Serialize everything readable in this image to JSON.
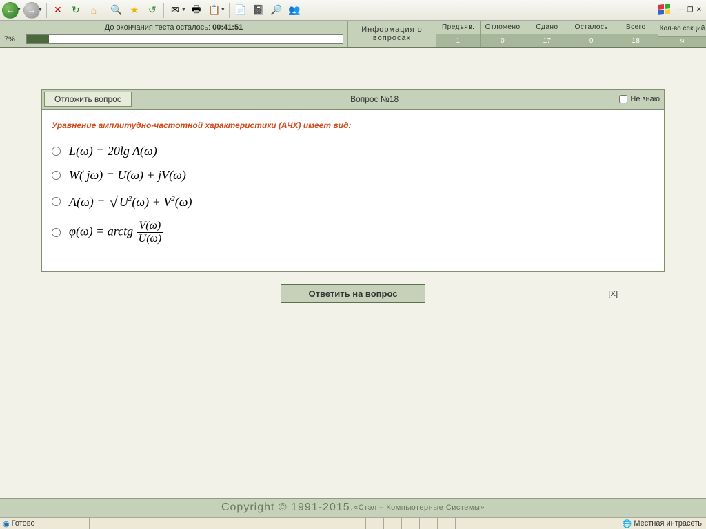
{
  "toolbar": {
    "back": "←",
    "forward": "→",
    "stop": "✕",
    "refresh": "↻",
    "home": "⌂",
    "search": "🔍",
    "favorites": "★",
    "history": "↺",
    "mail": "✉",
    "print": "🖶",
    "edit": "📋",
    "notes": "📄",
    "office": "📓",
    "research": "🔎",
    "messenger": "👥"
  },
  "wincontrols": {
    "min": "—",
    "restore": "❐",
    "close": "✕"
  },
  "timer": {
    "label_prefix": "До окончания теста осталось: ",
    "value": "00:41:51",
    "percent": "7%"
  },
  "info_label_line1": "Информация о",
  "info_label_line2": "вопросах",
  "stats": {
    "headers": [
      "Предъяв.",
      "Отложено",
      "Сдано",
      "Осталось",
      "Всего"
    ],
    "values": [
      "1",
      "0",
      "17",
      "0",
      "18"
    ]
  },
  "sections": {
    "label": "Кол-во секций",
    "value": "9"
  },
  "question": {
    "postpone": "Отложить вопрос",
    "title": "Вопрос  №18",
    "dont_know": "Не знаю",
    "prompt": "Уравнение амплитудно-частотной характеристики (АЧХ) имеет вид:",
    "answer_btn": "Ответить на вопрос",
    "close_x": "[X]"
  },
  "options": {
    "opt1": "L(ω) = 20lg A(ω)",
    "opt2": "W( jω) = U(ω) + jV(ω)",
    "opt3_inner": "U²(ω) + V²(ω)",
    "opt3_prefix": "A(ω) = ",
    "opt4_prefix": "φ(ω) = arctg ",
    "opt4_num": "V(ω)",
    "opt4_den": "U(ω)"
  },
  "copyright": {
    "main": "Copyright  © 1991-2015. ",
    "sub": "«Стэл – Компьютерные Системы»"
  },
  "status": {
    "ready": "Готово",
    "zone": "Местная интрасеть"
  }
}
